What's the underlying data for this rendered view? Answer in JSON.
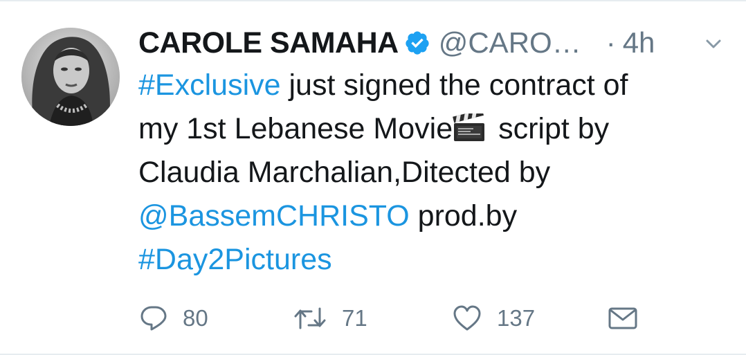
{
  "tweet": {
    "display_name": "CAROLE SAMAHA",
    "verified": true,
    "handle": "@CARO…",
    "separator": "·",
    "time": "4h",
    "text": {
      "hashtag_exclusive": "#Exclusive",
      "line1_rest": " just signed the contract of",
      "line2_start": "my 1st Lebanese Movie",
      "line2_end": " script by",
      "line3": "Claudia Marchalian,Ditected by",
      "mention": "@BassemCHRISTO",
      "line4_rest": " prod.by",
      "hashtag_day2": "#Day2Pictures"
    }
  },
  "actions": {
    "replies": "80",
    "retweets": "71",
    "likes": "137"
  },
  "icons": {
    "verified": "verified-badge-icon",
    "menu": "chevron-down-icon",
    "emoji": "clapper-board-icon",
    "reply": "reply-bubble-icon",
    "retweet": "retweet-icon",
    "like": "heart-icon",
    "dm": "envelope-icon"
  },
  "colors": {
    "link": "#1b95e0",
    "secondary_text": "#657786",
    "primary_text": "#14171a",
    "verified": "#1da1f2"
  }
}
